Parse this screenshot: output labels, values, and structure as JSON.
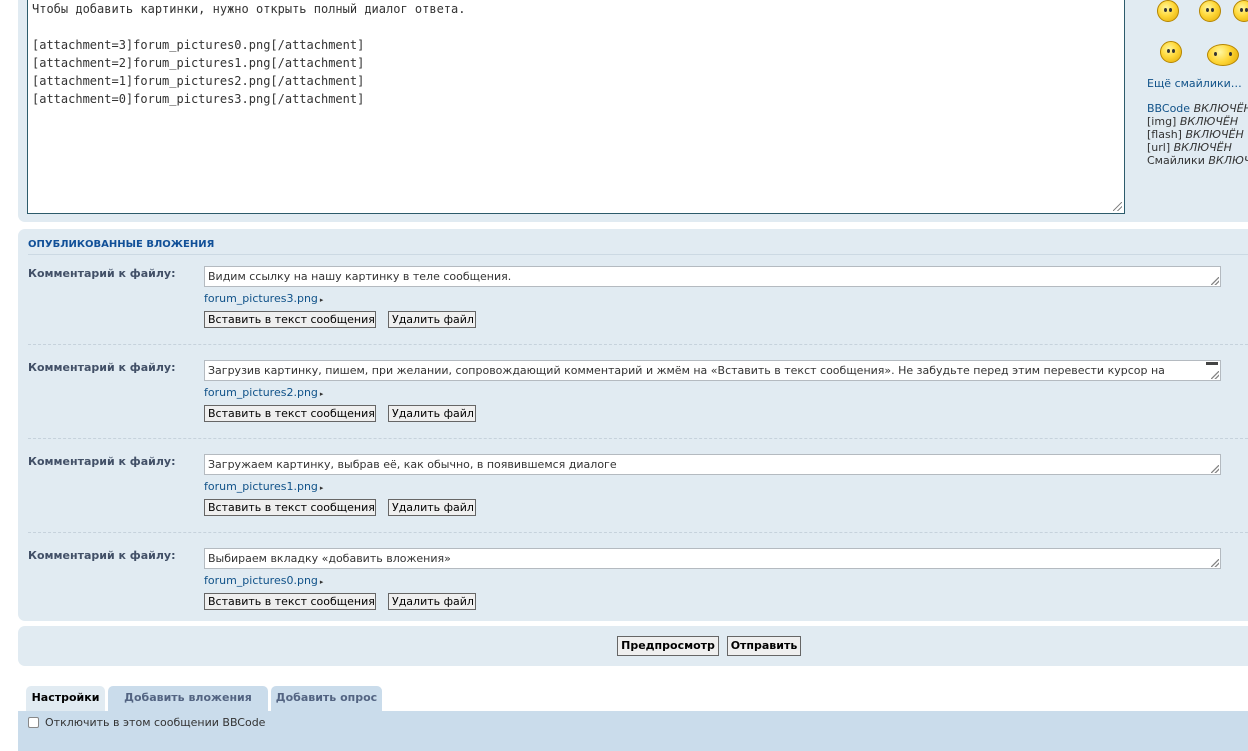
{
  "message": {
    "text": "Чтобы добавить картинки, нужно открыть полный диалог ответа.\n\n[attachment=3]forum_pictures0.png[/attachment]\n[attachment=2]forum_pictures1.png[/attachment]\n[attachment=1]forum_pictures2.png[/attachment]\n[attachment=0]forum_pictures3.png[/attachment]"
  },
  "sidebar": {
    "smilies": [
      "smiley-icon",
      "smiley-icon",
      "smiley-icon",
      "smiley-icon",
      "smiley-icon"
    ],
    "more_smilies": "Ещё смайлики…",
    "status": [
      {
        "name": "BBCode",
        "value": "ВКЛЮЧЁН"
      },
      {
        "name": "[img]",
        "value": "ВКЛЮЧЁН"
      },
      {
        "name": "[flash]",
        "value": "ВКЛЮЧЁН"
      },
      {
        "name": "[url]",
        "value": "ВКЛЮЧЁН"
      },
      {
        "name": "Смайлики",
        "value": "ВКЛЮЧЁН"
      }
    ]
  },
  "attachments": {
    "heading": "ОПУБЛИКОВАННЫЕ ВЛОЖЕНИЯ",
    "items": [
      {
        "label": "Комментарий к файлу:",
        "comment": "Видим ссылку на нашу картинку в теле сообщения.",
        "file": "forum_pictures3.png",
        "insert": "Вставить в текст сообщения",
        "delete": "Удалить файл"
      },
      {
        "label": "Комментарий к файлу:",
        "comment": "Загрузив картинку, пишем, при желании, сопровождающий комментарий и жмём на «Вставить в текст сообщения». Не забудьте перед этим перевести курсор на",
        "file": "forum_pictures2.png",
        "insert": "Вставить в текст сообщения",
        "delete": "Удалить файл"
      },
      {
        "label": "Комментарий к файлу:",
        "comment": "Загружаем картинку, выбрав её, как обычно, в появившемся диалоге",
        "file": "forum_pictures1.png",
        "insert": "Вставить в текст сообщения",
        "delete": "Удалить файл"
      },
      {
        "label": "Комментарий к файлу:",
        "comment": "Выбираем вкладку «добавить вложения»",
        "file": "forum_pictures0.png",
        "insert": "Вставить в текст сообщения",
        "delete": "Удалить файл"
      }
    ]
  },
  "actions": {
    "preview": "Предпросмотр",
    "submit": "Отправить"
  },
  "tabs": [
    "Настройки",
    "Добавить вложения",
    "Добавить опрос"
  ],
  "options": {
    "disable_bbcode": "Отключить в этом сообщении BBCode"
  }
}
